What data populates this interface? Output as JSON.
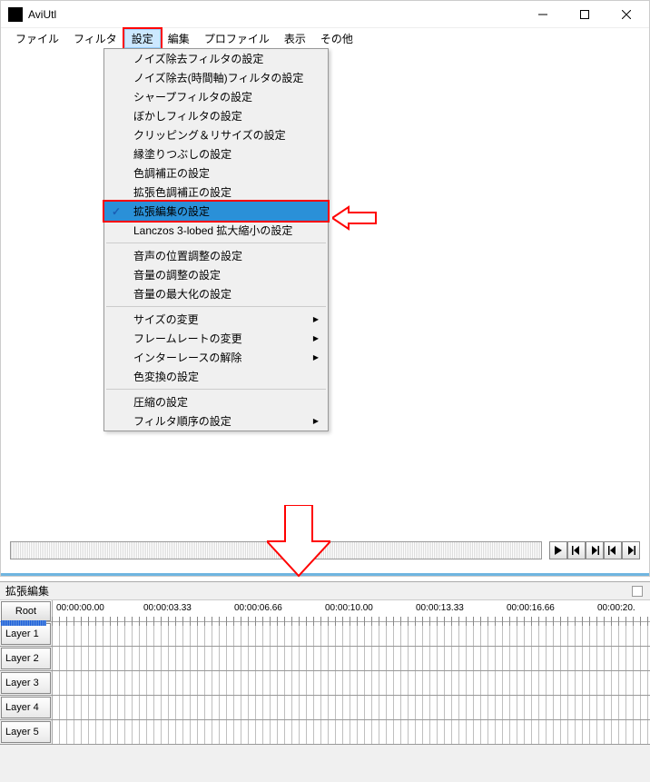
{
  "window": {
    "title": "AviUtl"
  },
  "menubar": {
    "items": [
      "ファイル",
      "フィルタ",
      "設定",
      "編集",
      "プロファイル",
      "表示",
      "その他"
    ],
    "active_index": 2
  },
  "dropdown": {
    "groups": [
      [
        {
          "label": "ノイズ除去フィルタの設定",
          "check": false,
          "sub": false
        },
        {
          "label": "ノイズ除去(時間軸)フィルタの設定",
          "check": false,
          "sub": false
        },
        {
          "label": "シャープフィルタの設定",
          "check": false,
          "sub": false
        },
        {
          "label": "ぼかしフィルタの設定",
          "check": false,
          "sub": false
        },
        {
          "label": "クリッピング＆リサイズの設定",
          "check": false,
          "sub": false
        },
        {
          "label": "縁塗りつぶしの設定",
          "check": false,
          "sub": false
        },
        {
          "label": "色調補正の設定",
          "check": false,
          "sub": false
        },
        {
          "label": "拡張色調補正の設定",
          "check": false,
          "sub": false
        },
        {
          "label": "拡張編集の設定",
          "check": true,
          "sub": false,
          "highlighted": true
        },
        {
          "label": "Lanczos 3-lobed 拡大縮小の設定",
          "check": false,
          "sub": false
        }
      ],
      [
        {
          "label": "音声の位置調整の設定",
          "check": false,
          "sub": false
        },
        {
          "label": "音量の調整の設定",
          "check": false,
          "sub": false
        },
        {
          "label": "音量の最大化の設定",
          "check": false,
          "sub": false
        }
      ],
      [
        {
          "label": "サイズの変更",
          "check": false,
          "sub": true
        },
        {
          "label": "フレームレートの変更",
          "check": false,
          "sub": true
        },
        {
          "label": "インターレースの解除",
          "check": false,
          "sub": true
        },
        {
          "label": "色変換の設定",
          "check": false,
          "sub": false
        }
      ],
      [
        {
          "label": "圧縮の設定",
          "check": false,
          "sub": false
        },
        {
          "label": "フィルタ順序の設定",
          "check": false,
          "sub": true
        }
      ]
    ]
  },
  "timeline": {
    "title": "拡張編集",
    "root": "Root",
    "times": [
      "00:00:00.00",
      "00:00:03.33",
      "00:00:06.66",
      "00:00:10.00",
      "00:00:13.33",
      "00:00:16.66",
      "00:00:20."
    ],
    "layers": [
      "Layer 1",
      "Layer 2",
      "Layer 3",
      "Layer 4",
      "Layer 5"
    ]
  }
}
